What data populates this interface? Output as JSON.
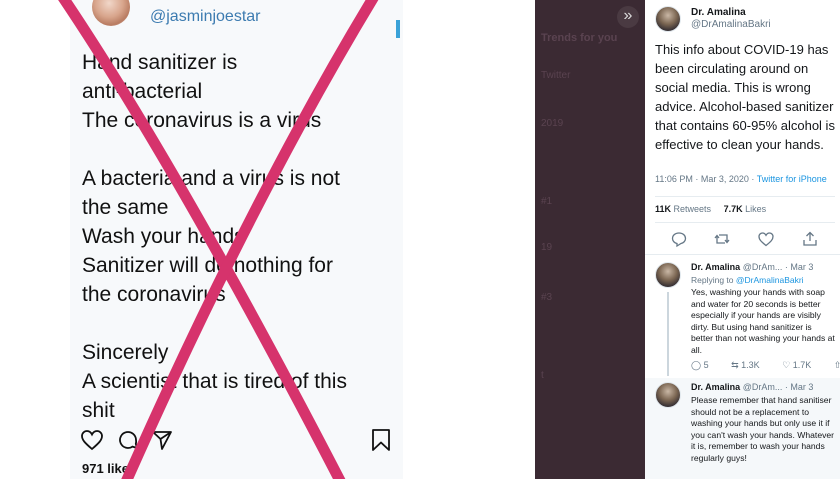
{
  "instagram": {
    "handle": "@jasminjoestar",
    "lines": [
      "Hand sanitizer is",
      "anti-bacterial",
      "The coronavirus is a virus",
      "",
      "A bacteria and a virus is not",
      "the same",
      "Wash your hands",
      "Sanitizer will do nothing for",
      "the coronavirus",
      "",
      "Sincerely",
      "A scientist that is tired of this",
      "shit"
    ],
    "likes": "971 likes",
    "icons": [
      "heart-icon",
      "comment-icon",
      "share-icon",
      "bookmark-icon"
    ]
  },
  "overlay": {
    "collapse_icon": "»",
    "faded_items": [
      "Trends for you",
      "Twitter",
      "2019",
      "#1",
      "19",
      "#3",
      "t"
    ]
  },
  "tweet": {
    "name": "Dr. Amalina",
    "handle": "@DrAmalinaBakri",
    "body": "This info about COVID-19 has been circulating around on social media. This is wrong advice. Alcohol-based sanitizer that contains 60-95% alcohol is effective to clean your hands.",
    "time": "11:06 PM · Mar 3, 2020 · ",
    "source": "Twitter for iPhone",
    "retweets_count": "11K",
    "retweets_label": "Retweets",
    "likes_count": "7.7K",
    "likes_label": "Likes"
  },
  "replies": [
    {
      "name": "Dr. Amalina",
      "handle_date": "@DrAm... · Mar 3",
      "replying_to_label": "Replying to ",
      "replying_to": "@DrAmalinaBakri",
      "body": "Yes, washing your hands with soap and water for 20 seconds is better especially if your hands are visibly dirty. But using hand sanitizer is better than not washing your hands at all.",
      "reply_count": "5",
      "retweet_count": "1.3K",
      "like_count": "1.7K"
    },
    {
      "name": "Dr. Amalina",
      "handle_date": "@DrAm... · Mar 3",
      "body": "Please remember that hand sanitiser should not be a replacement to washing your hands but only use it if you can't wash your hands. Whatever it is, remember to wash your hands regularly guys!"
    }
  ],
  "colors": {
    "cross": "#d6336c",
    "link": "#1b95e0",
    "overlay": "#3b2a33"
  }
}
